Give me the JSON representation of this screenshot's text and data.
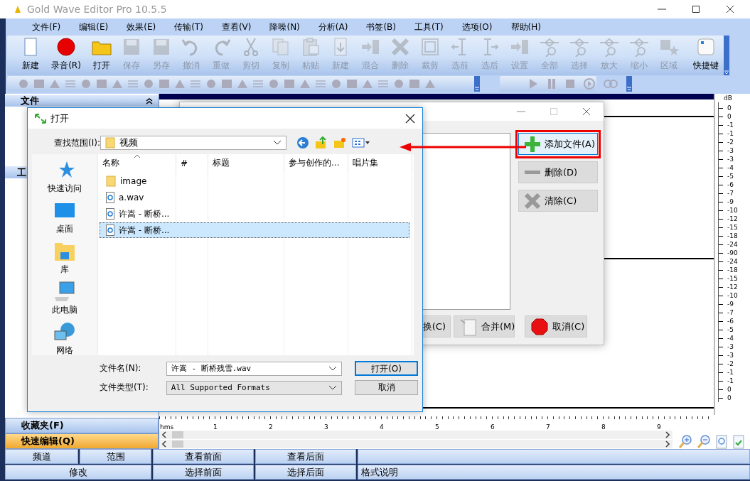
{
  "window": {
    "title": "Gold Wave Editor Pro 10.5.5"
  },
  "menu": [
    "文件(F)",
    "编辑(E)",
    "效果(E)",
    "传输(T)",
    "查看(V)",
    "降噪(N)",
    "分析(A)",
    "书签(B)",
    "工具(T)",
    "选项(O)",
    "帮助(H)"
  ],
  "toolbar": [
    {
      "label": "新建",
      "kind": "new",
      "disabled": false
    },
    {
      "label": "录音(R)",
      "kind": "record",
      "disabled": false
    },
    {
      "label": "打开",
      "kind": "open",
      "disabled": false
    },
    {
      "label": "保存",
      "kind": "save",
      "disabled": true
    },
    {
      "label": "另存",
      "kind": "save",
      "disabled": true
    },
    {
      "label": "撤消",
      "kind": "undo",
      "disabled": true
    },
    {
      "label": "重做",
      "kind": "redo",
      "disabled": true
    },
    {
      "label": "剪切",
      "kind": "cut",
      "disabled": true
    },
    {
      "label": "复制",
      "kind": "copy",
      "disabled": true
    },
    {
      "label": "粘贴",
      "kind": "paste",
      "disabled": true
    },
    {
      "label": "新建",
      "kind": "pastenew",
      "disabled": true
    },
    {
      "label": "混合",
      "kind": "mix",
      "disabled": true
    },
    {
      "label": "删除",
      "kind": "delete",
      "disabled": true
    },
    {
      "label": "裁剪",
      "kind": "trim",
      "disabled": true
    },
    {
      "label": "选前",
      "kind": "selstart",
      "disabled": true
    },
    {
      "label": "选后",
      "kind": "selend",
      "disabled": true
    },
    {
      "label": "设置",
      "kind": "set",
      "disabled": true
    },
    {
      "label": "全部",
      "kind": "view",
      "disabled": true
    },
    {
      "label": "选择",
      "kind": "view",
      "disabled": true
    },
    {
      "label": "放大",
      "kind": "zoomin",
      "disabled": true
    },
    {
      "label": "缩小",
      "kind": "zoomout",
      "disabled": true
    },
    {
      "label": "区域",
      "kind": "region",
      "disabled": true
    },
    {
      "label": "快捷键",
      "kind": "shortcut",
      "disabled": false
    }
  ],
  "sidebar": {
    "header": "文件",
    "section": "工",
    "bottom": [
      {
        "label": "收藏夹(F)",
        "selected": false
      },
      {
        "label": "快速编辑(Q)",
        "selected": true
      }
    ]
  },
  "wave": {
    "db_unit": "dB",
    "db_labels": [
      "0",
      "0",
      "-1",
      "-1",
      "-2",
      "-3",
      "-3",
      "-4",
      "-5",
      "-6",
      "-7",
      "-9",
      "-10",
      "-12",
      "-15",
      "-18",
      "-24",
      "-90",
      "-24",
      "-18",
      "-15",
      "-12",
      "-10",
      "-9",
      "-7",
      "-6",
      "-5",
      "-4",
      "-3",
      "-3",
      "-2",
      "-1",
      "-1",
      "0",
      "0"
    ],
    "time_unit": "hms",
    "time_labels": [
      "1",
      "2",
      "3",
      "4",
      "5",
      "6",
      "7",
      "8",
      "9"
    ]
  },
  "bottom_rows": [
    [
      "频道",
      "范围",
      "查看前面",
      "查看后面"
    ],
    [
      "修改",
      "选择前面",
      "选择后面",
      "格式说明"
    ]
  ],
  "merge_dialog": {
    "side_buttons": [
      {
        "label": "添加文件(A)",
        "kind": "plus",
        "highlighted": true
      },
      {
        "label": "删除(D)",
        "kind": "minus",
        "highlighted": false
      },
      {
        "label": "清除(C)",
        "kind": "cross",
        "highlighted": false
      }
    ],
    "bottom_buttons": [
      {
        "label": "换(C)",
        "kind": "none"
      },
      {
        "label": "合并(M)",
        "kind": "page"
      },
      {
        "label": "取消(C)",
        "kind": "stop"
      }
    ]
  },
  "open_dialog": {
    "title": "打开",
    "look_in_label": "查找范围(I):",
    "look_in": "视频",
    "places": [
      {
        "label": "快速访问",
        "kind": "star"
      },
      {
        "label": "桌面",
        "kind": "desktop"
      },
      {
        "label": "库",
        "kind": "library"
      },
      {
        "label": "此电脑",
        "kind": "computer"
      },
      {
        "label": "网络",
        "kind": "network"
      }
    ],
    "columns": [
      "名称",
      "#",
      "标题",
      "参与创作的...",
      "唱片集"
    ],
    "files": [
      {
        "name": "image",
        "kind": "folder",
        "selected": false
      },
      {
        "name": "a.wav",
        "kind": "audio",
        "selected": false
      },
      {
        "name": "许嵩 - 断桥...",
        "kind": "audio",
        "selected": false
      },
      {
        "name": "许嵩 - 断桥...",
        "kind": "audio",
        "selected": true
      }
    ],
    "filename_label": "文件名(N):",
    "filename": "许嵩 - 断桥残雪.wav",
    "filetype_label": "文件类型(T):",
    "filetype": "All Supported Formats",
    "buttons": [
      "打开(O)",
      "取消"
    ]
  }
}
